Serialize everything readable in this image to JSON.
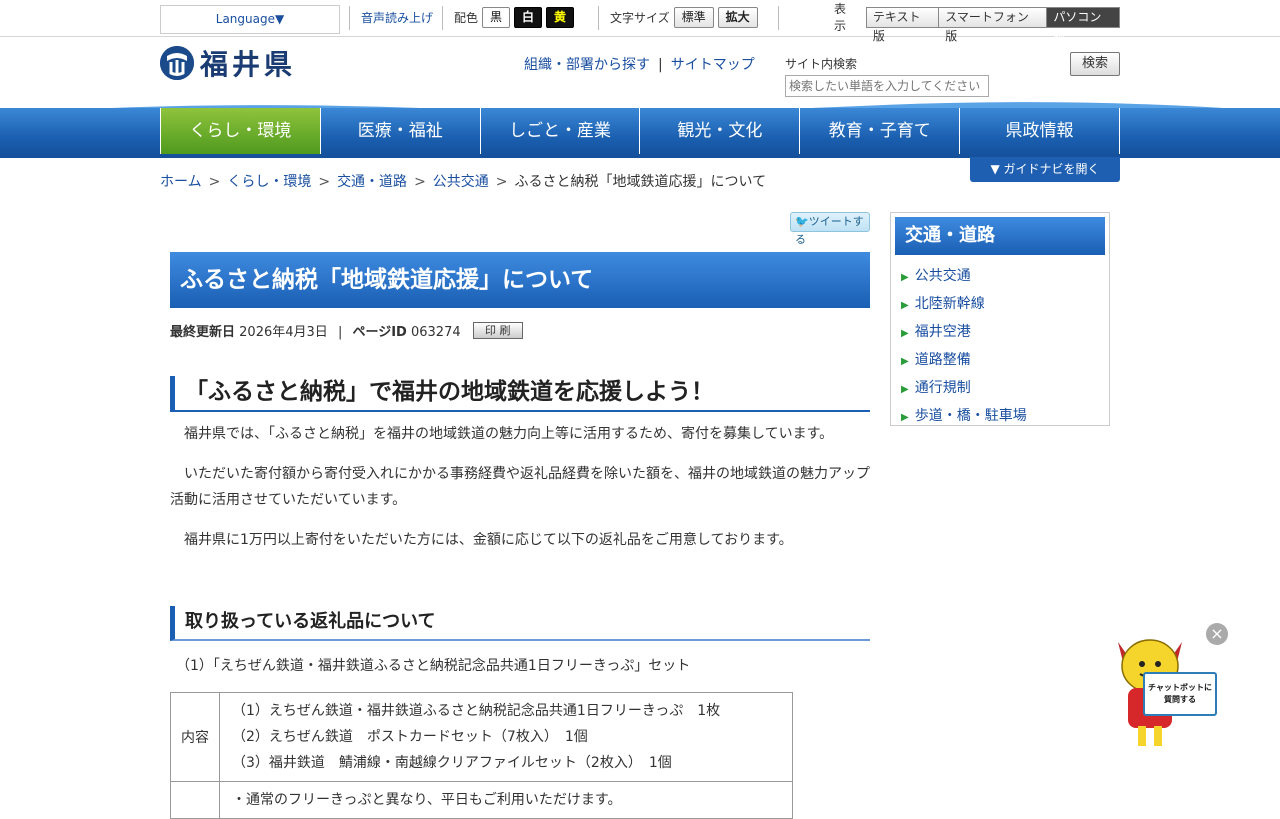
{
  "topbar": {
    "language": "Language▼",
    "voice": "音声読み上げ",
    "color_label": "配色",
    "color_black": "黒",
    "color_white": "白",
    "color_yellow": "黄",
    "textsize_label": "文字サイズ",
    "size_normal": "標準",
    "size_large": "拡大",
    "display_label": "表示",
    "display_text": "テキスト版",
    "display_smart": "スマートフォン版",
    "display_pc": "パソコン版"
  },
  "header": {
    "logo": "福井県",
    "link_org": "組織・部署から探す",
    "link_sitemap": "サイトマップ",
    "search_label": "サイト内検索",
    "search_placeholder": "検索したい単語を入力してください",
    "search_button": "検索"
  },
  "nav": {
    "items": [
      "くらし・環境",
      "医療・福祉",
      "しごと・産業",
      "観光・文化",
      "教育・子育て",
      "県政情報"
    ]
  },
  "breadcrumb": {
    "home": "ホーム",
    "c1": "くらし・環境",
    "c2": "交通・道路",
    "c3": "公共交通",
    "current": "ふるさと納税「地域鉄道応援」について"
  },
  "guide_nav": "▼ ガイドナビを開く",
  "tweet": "ツイートする",
  "article": {
    "title": "ふるさと納税「地域鉄道応援」について",
    "updated_label": "最終更新日",
    "updated_value": "2026年4月3日",
    "pageid_label": "ページID",
    "pageid_value": "063274",
    "print": "印 刷",
    "h2": "「ふるさと納税」で福井の地域鉄道を応援しよう！",
    "p1": "福井県では、「ふるさと納税」を福井の地域鉄道の魅力向上等に活用するため、寄付を募集しています。",
    "p2": "いただいた寄付額から寄付受入れにかかる事務経費や返礼品経費を除いた額を、福井の地域鉄道の魅力アップ活動に活用させていただいています。",
    "p3": "福井県に1万円以上寄付をいただいた方には、金額に応じて以下の返礼品をご用意しております。",
    "h3": "取り扱っている返礼品について",
    "item1": "（1）「えちぜん鉄道・福井鉄道ふるさと納税記念品共通1日フリーきっぷ」セット",
    "table": {
      "row1_head": "内容",
      "row1_lines": [
        "（1）えちぜん鉄道・福井鉄道ふるさと納税記念品共通1日フリーきっぷ　1枚",
        "（2）えちぜん鉄道　ポストカードセット（7枚入）　1個",
        "（3）福井鉄道　鯖浦線・南越線クリアファイルセット（2枚入）　1個"
      ],
      "row2_line": "・通常のフリーきっぷと異なり、平日もご利用いただけます。"
    }
  },
  "side": {
    "title": "交通・道路",
    "items": [
      "公共交通",
      "北陸新幹線",
      "福井空港",
      "道路整備",
      "通行規制",
      "歩道・橋・駐車場"
    ]
  },
  "chatbot": {
    "close": "×",
    "sign_line1": "チャットボットに",
    "sign_line2": "質問する"
  }
}
